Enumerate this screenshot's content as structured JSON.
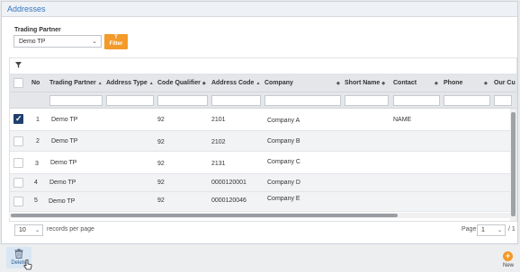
{
  "panel": {
    "title": "Addresses"
  },
  "filter": {
    "trading_partner_label": "Trading Partner",
    "trading_partner_value": "Demo TP",
    "filter_button_label": "Filter"
  },
  "columns": [
    {
      "label": "No",
      "sort": ""
    },
    {
      "label": "Trading Partner",
      "sort": "▲"
    },
    {
      "label": "Address Type",
      "sort": "▲"
    },
    {
      "label": "Code Qualifier",
      "sort": "◆"
    },
    {
      "label": "Address Code",
      "sort": "▲"
    },
    {
      "label": "Company",
      "sort": "◆"
    },
    {
      "label": "Short Name",
      "sort": "◆"
    },
    {
      "label": "Contact",
      "sort": "◆"
    },
    {
      "label": "Phone",
      "sort": "◆"
    },
    {
      "label": "Our Cu",
      "sort": ""
    }
  ],
  "rows": [
    {
      "checked": true,
      "no": "1",
      "trading_partner": "Demo TP",
      "code_qualifier": "92",
      "address_code": "2101",
      "company": "Company A",
      "contact": "NAME"
    },
    {
      "checked": false,
      "no": "2",
      "trading_partner": "Demo TP",
      "code_qualifier": "92",
      "address_code": "2102",
      "company": "Company B",
      "contact": ""
    },
    {
      "checked": false,
      "no": "3",
      "trading_partner": "Demo TP",
      "code_qualifier": "92",
      "address_code": "2131",
      "company": "Company C",
      "contact": ""
    },
    {
      "checked": false,
      "no": "4",
      "trading_partner": "Demo TP",
      "code_qualifier": "92",
      "address_code": "0000120001",
      "company": "Company D",
      "contact": ""
    },
    {
      "checked": false,
      "no": "5",
      "trading_partner": "Demo TP",
      "code_qualifier": "92",
      "address_code": "0000120046",
      "company": "Company E",
      "contact": ""
    }
  ],
  "pager": {
    "per_page": "10",
    "per_page_label": "records per page",
    "page_label": "Page",
    "page": "1",
    "total_pages": "/ 1"
  },
  "footer": {
    "delete_label": "Delete",
    "new_label": "New"
  },
  "colors": {
    "accent_orange": "#f39a2a",
    "title_blue": "#3577c2",
    "checkbox_checked": "#1f3f6e"
  },
  "icons": [
    "funnel-icon",
    "chevron-down-icon",
    "trash-icon",
    "plus-circle-icon",
    "hand-cursor-icon"
  ]
}
